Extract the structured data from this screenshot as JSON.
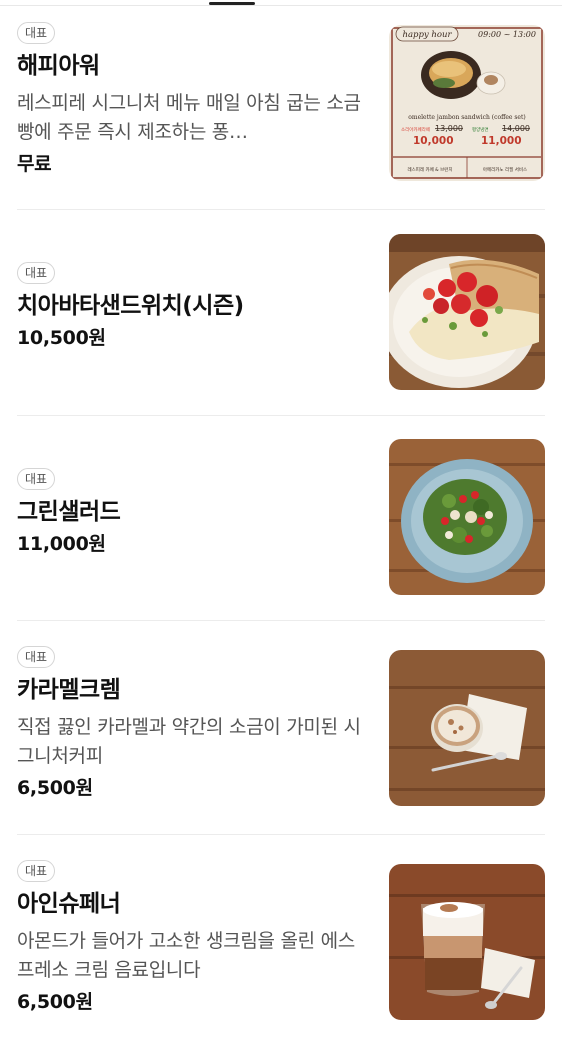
{
  "tabs": {
    "active_indicator": "active-tab"
  },
  "menu": {
    "items": [
      {
        "badge": "대표",
        "name": "해피아워",
        "description": "레스피레 시그니처 메뉴 매일 아침 굽는 소금빵에 주문 즉시 제조하는 퐁…",
        "price": "무료",
        "image": {
          "title": "happy hour",
          "hours": "09:00 ~ 13:00",
          "subtitle": "omelette jambon sandwich (coffee set)",
          "price_a_label": "소리아카페라떼",
          "price_a_old": "13,000",
          "price_a_new": "10,000",
          "price_b_label": "평양냉면",
          "price_b_old": "14,000",
          "price_b_new": "11,000",
          "footer_left": "레스피레 카페 & 브런치",
          "footer_right": "아메리카노 리필 서비스"
        }
      },
      {
        "badge": "대표",
        "name": "치아바타샌드위치(시즌)",
        "description": "",
        "price": "10,500원"
      },
      {
        "badge": "대표",
        "name": "그린샐러드",
        "description": "",
        "price": "11,000원"
      },
      {
        "badge": "대표",
        "name": "카라멜크렘",
        "description": "직접 끓인 카라멜과 약간의 소금이 가미된 시그니처커피",
        "price": "6,500원"
      },
      {
        "badge": "대표",
        "name": "아인슈페너",
        "description": "아몬드가 들어가 고소한 생크림을 올린 에스프레소 크림 음료입니다",
        "price": "6,500원"
      }
    ]
  },
  "colors": {
    "price_old_red": "#d9453a",
    "price_new_red": "#c0392b",
    "menu_border": "#8a3a2c"
  }
}
